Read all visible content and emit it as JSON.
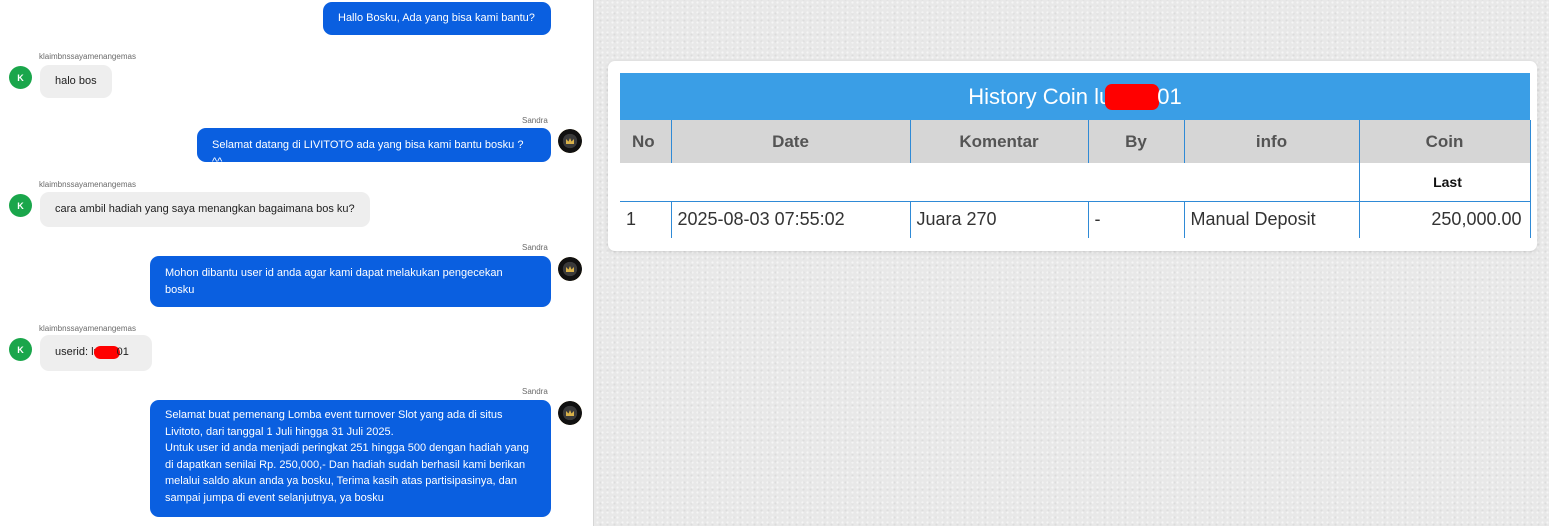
{
  "chat": {
    "agent_name": "Sandra",
    "user_name": "klaimbnssayamenangemas",
    "user_avatar_letter": "K",
    "messages": [
      {
        "from": "agent",
        "text": "Hallo Bosku, Ada yang bisa kami bantu?"
      },
      {
        "from": "user",
        "text": "halo bos"
      },
      {
        "from": "agent",
        "text": "Selamat datang di LIVITOTO ada yang bisa kami bantu bosku ? ^^"
      },
      {
        "from": "user",
        "text": "cara ambil hadiah yang saya menangkan bagaimana bos ku?"
      },
      {
        "from": "agent",
        "lines": [
          "Mohon dibantu user id anda agar kami dapat melakukan pengecekan",
          "bosku"
        ]
      },
      {
        "from": "user",
        "prefix": "userid: lu",
        "suffix": "01"
      },
      {
        "from": "agent",
        "lines": [
          "Selamat buat pemenang Lomba event turnover Slot yang ada di situs",
          "Livitoto, dari tanggal 1 Juli hingga 31 Juli 2025.",
          "Untuk user id anda menjadi peringkat 251 hingga 500 dengan hadiah yang",
          "di dapatkan senilai Rp. 250,000,- Dan hadiah sudah berhasil kami berikan",
          "melalui saldo akun anda ya bosku, Terima kasih atas partisipasinya, dan",
          "sampai jumpa di event selanjutnya, ya bosku"
        ]
      }
    ]
  },
  "history": {
    "title_prefix": "History Coin lu",
    "title_suffix": "01",
    "columns": [
      "No",
      "Date",
      "Komentar",
      "By",
      "info",
      "Coin"
    ],
    "last_label": "Last",
    "rows": [
      {
        "no": "1",
        "date": "2025-08-03 07:55:02",
        "komentar": "Juara 270",
        "by": "-",
        "info": "Manual Deposit",
        "coin": "250,000.00"
      }
    ]
  },
  "colors": {
    "agent_bubble": "#0a5fe0",
    "user_bubble": "#eeeeee",
    "user_avatar": "#1aa64b",
    "header_blue": "#3a9ee6",
    "redaction": "#ff0000"
  }
}
